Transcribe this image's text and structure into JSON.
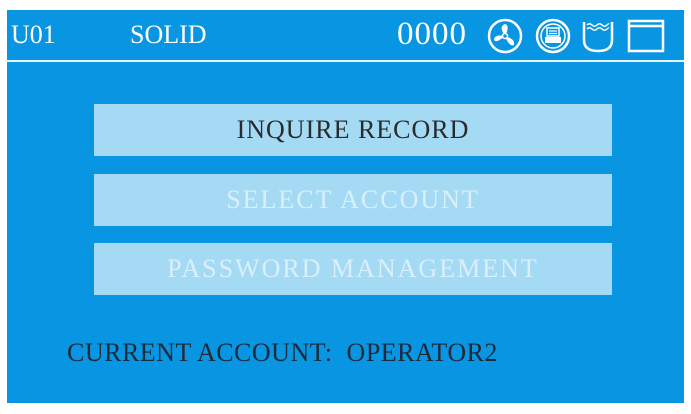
{
  "header": {
    "unit_code": "U01",
    "mode": "SOLID",
    "counter": "0000",
    "icons": [
      "fan-icon",
      "print-icon",
      "water-tank-icon",
      "window-icon"
    ]
  },
  "menu": {
    "items": [
      {
        "label": "INQUIRE RECORD",
        "state": "active"
      },
      {
        "label": "SELECT ACCOUNT",
        "state": "inactive"
      },
      {
        "label": "PASSWORD MANAGEMENT",
        "state": "inactive"
      }
    ]
  },
  "status": {
    "label": "CURRENT ACCOUNT:",
    "value": "OPERATOR2"
  },
  "colors": {
    "background": "#0895e2",
    "button": "#a5daf5",
    "active_text": "#2a2a2a",
    "inactive_text": "#d9f0fc"
  }
}
